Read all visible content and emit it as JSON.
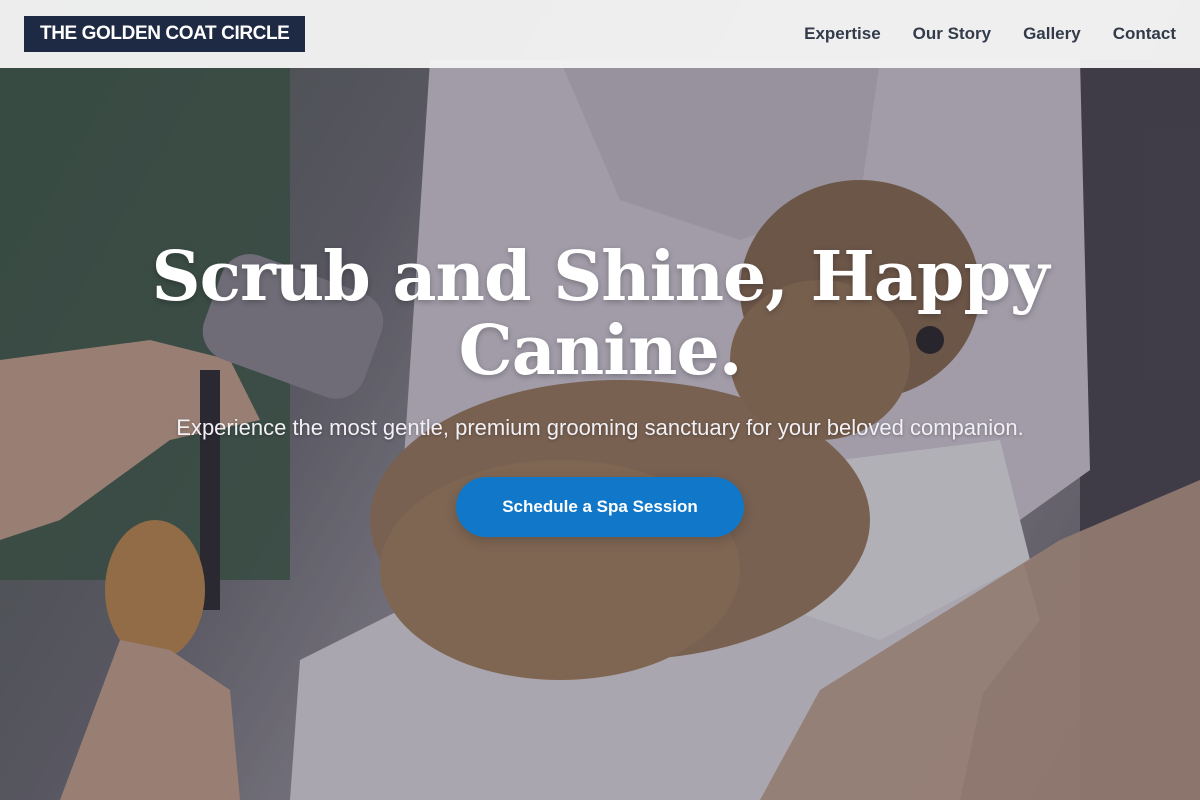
{
  "brand": {
    "name": "THE GOLDEN COAT CIRCLE"
  },
  "nav": {
    "items": [
      {
        "label": "Expertise"
      },
      {
        "label": "Our Story"
      },
      {
        "label": "Gallery"
      },
      {
        "label": "Contact"
      }
    ]
  },
  "hero": {
    "headline": "Scrub and Shine, Happy Canine.",
    "subheadline": "Experience the most gentle, premium grooming sanctuary for your beloved companion.",
    "cta_label": "Schedule a Spa Session",
    "background_description_icon": "dog-grooming-photo"
  },
  "colors": {
    "header_bg": "#f5f5f6",
    "logo_bg": "#1e2a44",
    "nav_text": "#333b4a",
    "cta_bg": "#1178c9",
    "headline_text": "#ffffff"
  }
}
